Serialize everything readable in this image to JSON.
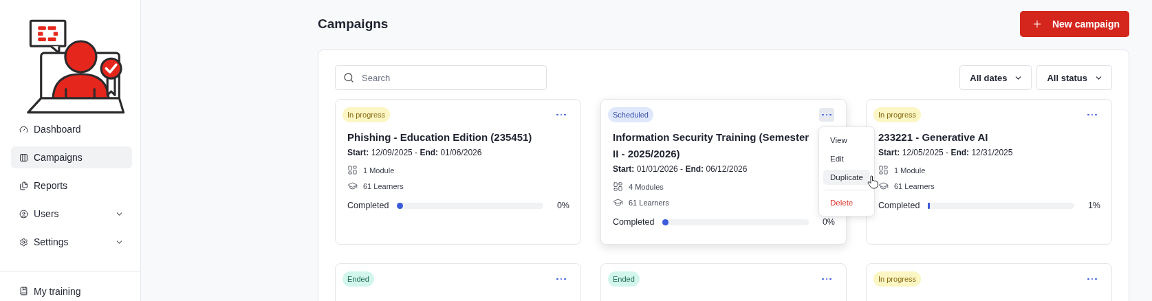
{
  "sidebar": {
    "items": [
      {
        "label": "Dashboard",
        "selected": false,
        "expandable": false
      },
      {
        "label": "Campaigns",
        "selected": true,
        "expandable": false
      },
      {
        "label": "Reports",
        "selected": false,
        "expandable": false
      },
      {
        "label": "Users",
        "selected": false,
        "expandable": true
      },
      {
        "label": "Settings",
        "selected": false,
        "expandable": true
      }
    ],
    "footer_items": [
      {
        "label": "My training",
        "selected": false
      }
    ]
  },
  "header": {
    "title": "Campaigns",
    "new_button": "New campaign"
  },
  "search": {
    "placeholder": "Search"
  },
  "filters": [
    "All dates",
    "All status"
  ],
  "cards": [
    {
      "status": "In progress",
      "kind": "progress",
      "title": "Phishing - Education Edition (235451)",
      "dates": "**Start:** 12/09/2025 - **End:** 01/06/2026",
      "modules": "1 Module",
      "learners": "61 Learners",
      "progress_label": "Completed",
      "level": 0,
      "percent": "0%",
      "menu_open": false
    },
    {
      "status": "Scheduled",
      "kind": "scheduled",
      "title": "Information Security Training (Semester II - 2025/2026)",
      "dates": "**Start:** 01/01/2026 - **End:** 06/12/2026",
      "modules": "4 Modules",
      "learners": "61 Learners",
      "progress_label": "Completed",
      "level": 0,
      "percent": "0%",
      "menu_open": true,
      "menu": [
        {
          "label": "View",
          "kind": "normal",
          "highlighted": false
        },
        {
          "label": "Edit",
          "kind": "normal",
          "highlighted": false
        },
        {
          "label": "Duplicate",
          "kind": "normal",
          "highlighted": true
        },
        {
          "label": "Delete",
          "kind": "danger",
          "highlighted": false
        }
      ]
    },
    {
      "status": "In progress",
      "kind": "progress",
      "title": "233221 - Generative AI",
      "dates": "**Start:** 12/05/2025 - **End:** 12/31/2025",
      "modules": "1 Module",
      "learners": "61 Learners",
      "progress_label": "Completed",
      "level": 0.01,
      "percent": "1%",
      "menu_open": false
    },
    {
      "status": "Ended",
      "kind": "ended",
      "menu_open": false
    },
    {
      "status": "Ended",
      "kind": "ended",
      "menu_open": false
    },
    {
      "status": "In progress",
      "kind": "progress",
      "menu_open": false
    }
  ]
}
